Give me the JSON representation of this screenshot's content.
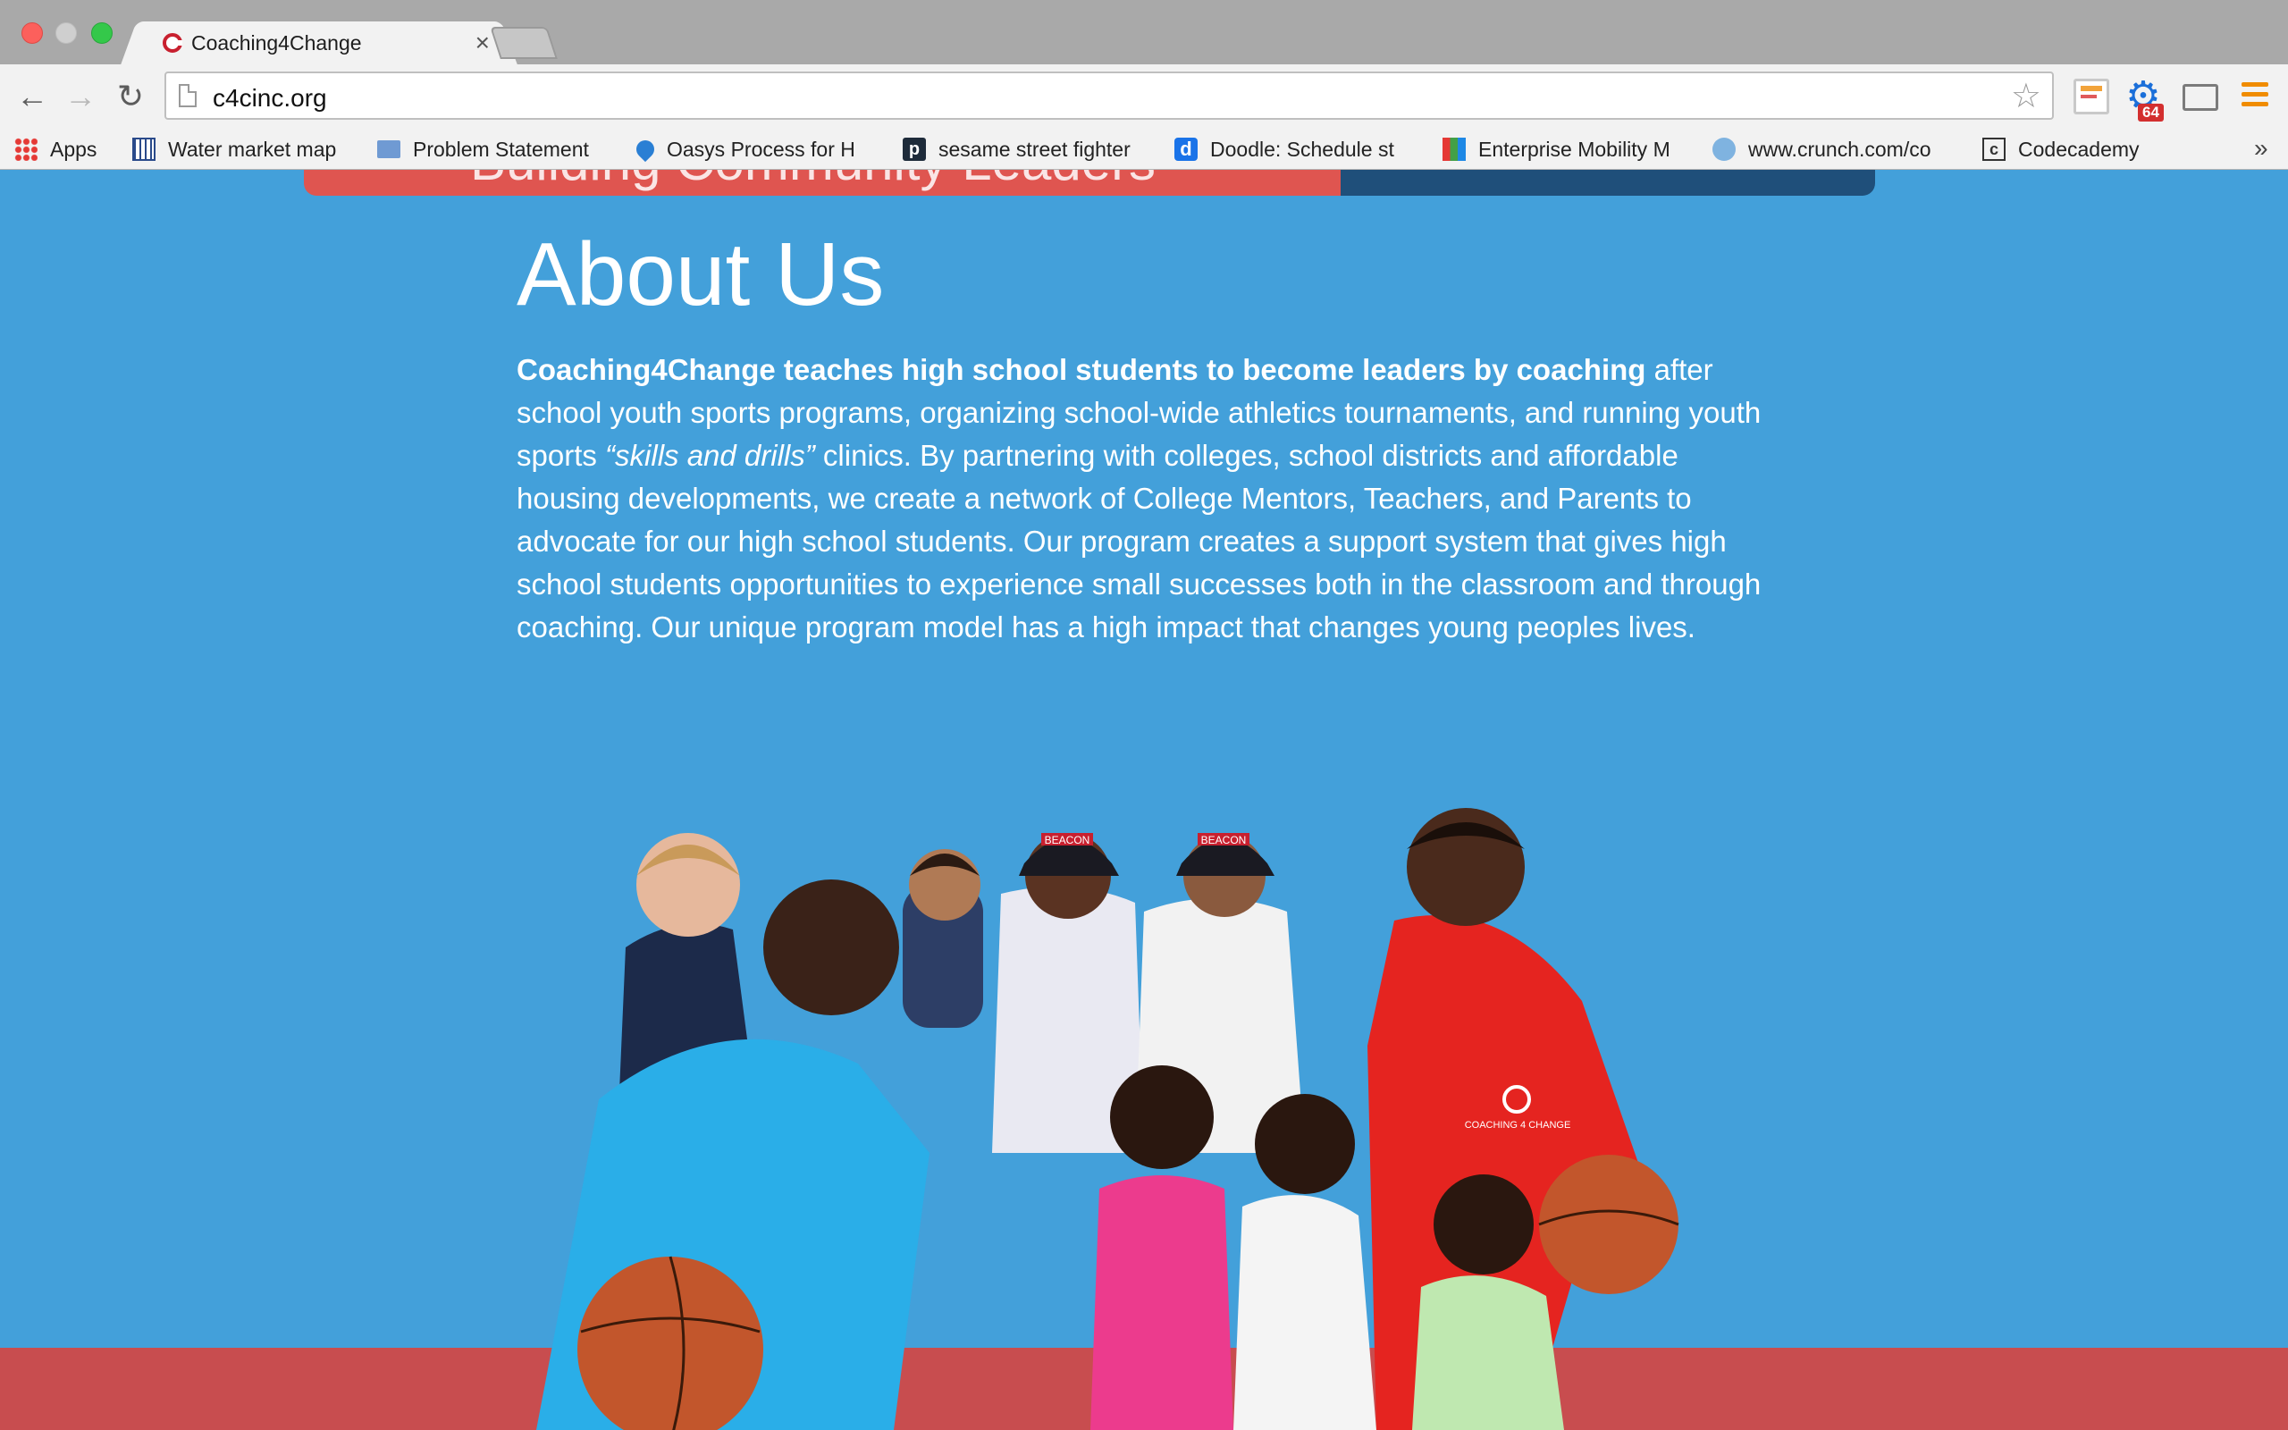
{
  "browser": {
    "tab_title": "Coaching4Change",
    "tab_close": "×",
    "url": "c4cinc.org",
    "extension_badge": "64",
    "bookmarks": [
      {
        "label": "Apps",
        "icon": "apps-grid-icon"
      },
      {
        "label": "Water market map",
        "icon": "grid-map-icon"
      },
      {
        "label": "Problem Statement",
        "icon": "folder-icon"
      },
      {
        "label": "Oasys Process for H",
        "icon": "drop-icon"
      },
      {
        "label": "sesame street fighter",
        "icon": "p-logo-icon"
      },
      {
        "label": "Doodle: Schedule st",
        "icon": "doodle-icon"
      },
      {
        "label": "Enterprise Mobility M",
        "icon": "colorbar-icon"
      },
      {
        "label": "www.crunch.com/co",
        "icon": "globe-icon"
      },
      {
        "label": "Codecademy",
        "icon": "codecademy-icon"
      }
    ],
    "overflow": "»"
  },
  "page": {
    "banner_text": "Building Community Leaders",
    "about_title": "About Us",
    "about_lead": "Coaching4Change teaches high school students to become leaders by coaching",
    "about_part1": " after school youth sports programs, organizing school-wide athletics tournaments, and running youth sports ",
    "about_italic": "“skills and drills”",
    "about_part2": " clinics. By partnering with colleges, school districts and affordable housing developments, we create a network of College Mentors, Teachers, and Parents to advocate for our high school students. Our program creates a support system that gives high school students opportunities to experience small successes both in the classroom and through coaching. Our unique program model has a high impact that changes young peoples lives.",
    "cap_text": "BEACON",
    "shirt_logo_text": "COACHING 4 CHANGE"
  },
  "colors": {
    "page_blue": "#43a0da",
    "banner_red": "#df5550",
    "banner_navy": "#1f4f7a",
    "footer_red": "#c84d4f"
  }
}
